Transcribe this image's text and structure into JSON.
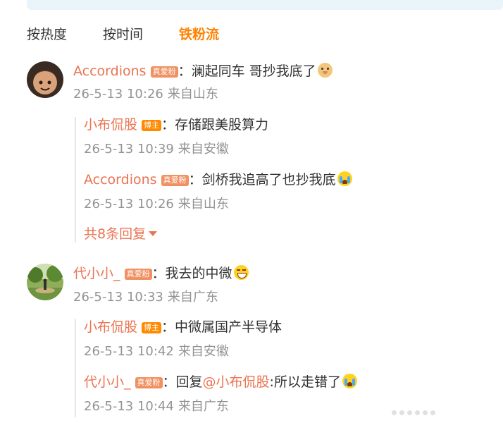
{
  "sort_tabs": [
    {
      "label": "按热度"
    },
    {
      "label": "按时间"
    },
    {
      "label": "铁粉流"
    }
  ],
  "comments": [
    {
      "user": "Accordions",
      "badge": "真爱粉",
      "text": "：澜起同车 哥抄我底了",
      "emoji": "doge-icon",
      "time": "26-5-13 10:26",
      "location": "来自山东",
      "replies": [
        {
          "user": "小布侃股",
          "badge": "博主",
          "text": "：存储跟美股算力",
          "time": "26-5-13 10:39",
          "location": "来自安徽"
        },
        {
          "user": "Accordions",
          "badge": "真爱粉",
          "text": "：剑桥我追高了也抄我底",
          "emoji": "crying-icon",
          "time": "26-5-13 10:26",
          "location": "来自山东"
        }
      ],
      "more_replies": "共8条回复"
    },
    {
      "user": "代小小_",
      "badge": "真爱粉",
      "text": "：我去的中微",
      "emoji": "laughing-icon",
      "time": "26-5-13 10:33",
      "location": "来自广东",
      "replies": [
        {
          "user": "小布侃股",
          "badge": "博主",
          "text": "：中微属国产半导体",
          "time": "26-5-13 10:42",
          "location": "来自安徽"
        },
        {
          "user": "代小小_",
          "badge": "真爱粉",
          "text_prefix": "：回复",
          "mention": "@小布侃股",
          "text_suffix": ":所以走错了",
          "emoji": "crying-icon",
          "time": "26-5-13 10:44",
          "location": "来自广东"
        }
      ]
    }
  ]
}
